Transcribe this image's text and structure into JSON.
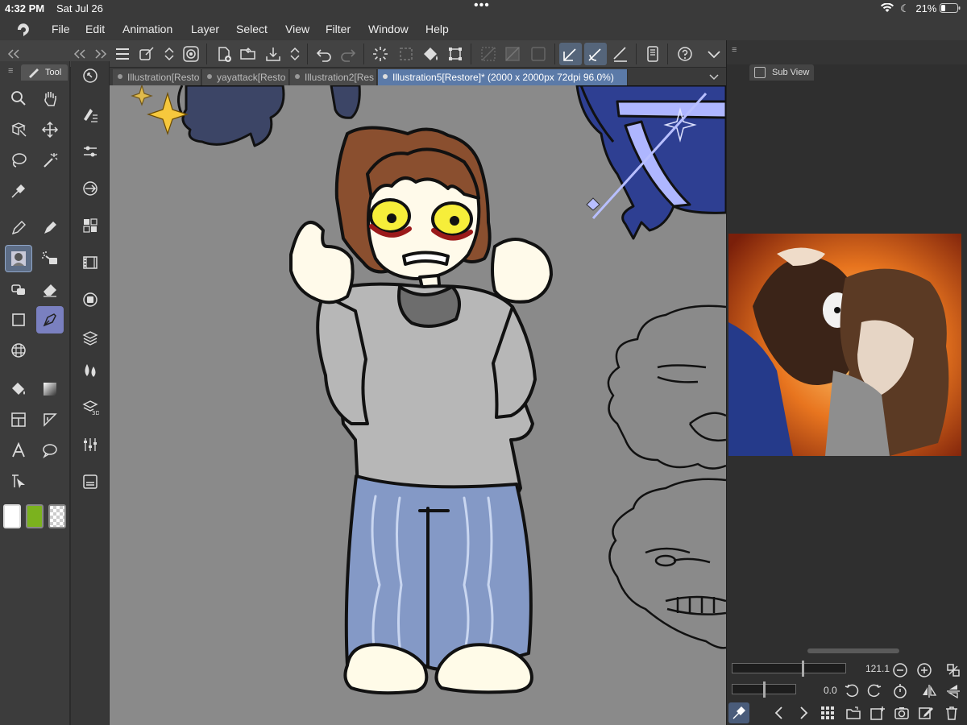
{
  "status": {
    "time": "4:32 PM",
    "date": "Sat Jul 26",
    "dots": "•••",
    "battery": "21%"
  },
  "menu": [
    {
      "label": "File"
    },
    {
      "label": "Edit"
    },
    {
      "label": "Animation"
    },
    {
      "label": "Layer"
    },
    {
      "label": "Select"
    },
    {
      "label": "View"
    },
    {
      "label": "Filter"
    },
    {
      "label": "Window"
    },
    {
      "label": "Help"
    }
  ],
  "tabs": [
    {
      "label": "Illustration[Resto"
    },
    {
      "label": "yayattack[Resto"
    },
    {
      "label": "Illustration2[Res"
    },
    {
      "label": "Illustration5[Restore]* (2000 x 2000px 72dpi 96.0%)"
    }
  ],
  "tool_panel": {
    "title": "Tool"
  },
  "sub_view": {
    "title": "Sub View"
  },
  "controls": {
    "zoom_value": "121.1",
    "rotate_value": "0.0"
  },
  "colors": {
    "accent": "#5b7aa8",
    "main_color": "#ffffff",
    "sub_color": "#7bb21e"
  }
}
